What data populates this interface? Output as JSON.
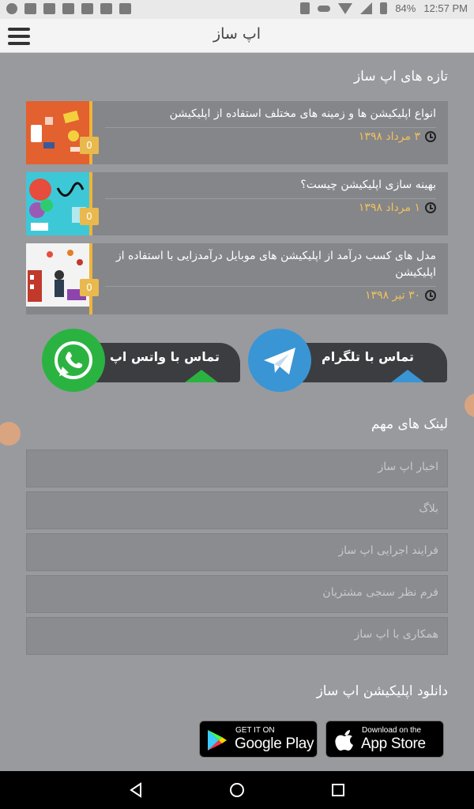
{
  "status_bar": {
    "battery": "84%",
    "time": "12:57 PM"
  },
  "app_bar": {
    "title": "اپ ساز",
    "menu_icon": "hamburger-menu-icon"
  },
  "news": {
    "heading": "تازه های اپ ساز",
    "items": [
      {
        "title": "انواع اپلیکیشن ها و زمینه های مختلف استفاده از اپلیکیشن",
        "date": "۳ مرداد ۱۳۹۸",
        "count": "0"
      },
      {
        "title": "بهینه سازی اپلیکیشن چیست؟",
        "date": "۱ مرداد ۱۳۹۸",
        "count": "0"
      },
      {
        "title": "مدل های کسب درآمد از اپلیکیشن های موبایل درآمدزایی با استفاده از اپلیکیشن",
        "date": "۳۰ تیر ۱۳۹۸",
        "count": "0"
      }
    ]
  },
  "contact": {
    "telegram_label": "تماس با تلگرام",
    "whatsapp_label": "تماس با واتس اپ",
    "telegram_color": "#3a95d4",
    "whatsapp_color": "#2bb341"
  },
  "links": {
    "heading": "لینک های مهم",
    "items": [
      "اخبار اپ ساز",
      "بلاگ",
      "فرایند اجرایی اپ ساز",
      "فرم نظر سنجی مشتریان",
      "همکاری با اپ ساز"
    ]
  },
  "download": {
    "heading": "دانلود اپلیکیشن اپ ساز",
    "google_play": {
      "small": "GET IT ON",
      "big": "Google Play"
    },
    "app_store": {
      "small": "Download on the",
      "big": "App Store"
    }
  }
}
